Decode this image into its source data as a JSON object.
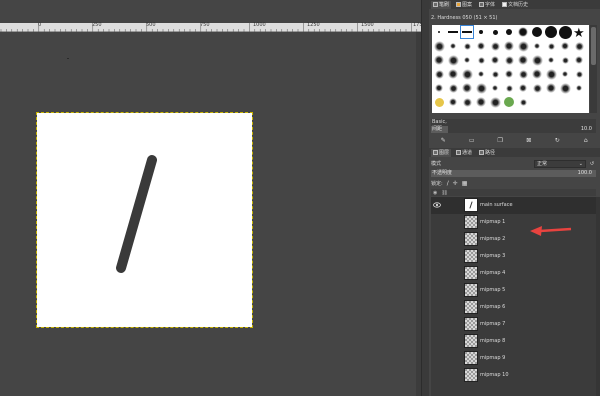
{
  "canvas": {
    "ruler_labels": [
      "0",
      "250",
      "500",
      "750",
      "1000",
      "1250",
      "1500",
      "1750"
    ],
    "image_background": "#ffffff",
    "stroke_color": "#3a3a3a"
  },
  "brushes_dock": {
    "tabs": [
      {
        "label": "笔刷",
        "icon": "brush-icon"
      },
      {
        "label": "图案",
        "icon": "pattern-icon"
      },
      {
        "label": "字体",
        "icon": "font-icon"
      },
      {
        "label": "文档历史",
        "icon": "history-icon"
      }
    ],
    "title": "2. Hardness 050 (51 × 51)",
    "tag_filter": "Basic,",
    "spacing": {
      "label": "间距",
      "value": "10.0",
      "fraction": 0.1
    },
    "actions": [
      "edit-brush-icon",
      "new-brush-icon",
      "duplicate-brush-icon",
      "delete-brush-icon",
      "refresh-brushes-icon",
      "open-folder-icon"
    ]
  },
  "layers_dock": {
    "tabs": [
      {
        "label": "图层",
        "icon": "layers-icon"
      },
      {
        "label": "通道",
        "icon": "channels-icon"
      },
      {
        "label": "路径",
        "icon": "paths-icon"
      }
    ],
    "mode_label": "模式",
    "mode_value": "正常",
    "opacity": {
      "label": "不透明度",
      "value": "100.0"
    },
    "lock_label": "锁定:",
    "layers": [
      {
        "name": "main surface",
        "visible": true,
        "active": true,
        "thumb": "white"
      },
      {
        "name": "mipmap 1",
        "visible": false,
        "active": false,
        "thumb": "transparent"
      },
      {
        "name": "mipmap 2",
        "visible": false,
        "active": false,
        "thumb": "transparent"
      },
      {
        "name": "mipmap 3",
        "visible": false,
        "active": false,
        "thumb": "transparent"
      },
      {
        "name": "mipmap 4",
        "visible": false,
        "active": false,
        "thumb": "transparent"
      },
      {
        "name": "mipmap 5",
        "visible": false,
        "active": false,
        "thumb": "transparent"
      },
      {
        "name": "mipmap 6",
        "visible": false,
        "active": false,
        "thumb": "transparent"
      },
      {
        "name": "mipmap 7",
        "visible": false,
        "active": false,
        "thumb": "transparent"
      },
      {
        "name": "mipmap 8",
        "visible": false,
        "active": false,
        "thumb": "transparent"
      },
      {
        "name": "mipmap 9",
        "visible": false,
        "active": false,
        "thumb": "transparent"
      },
      {
        "name": "mipmap 10",
        "visible": false,
        "active": false,
        "thumb": "transparent"
      }
    ],
    "annotation_arrow_color": "#e8433f"
  }
}
